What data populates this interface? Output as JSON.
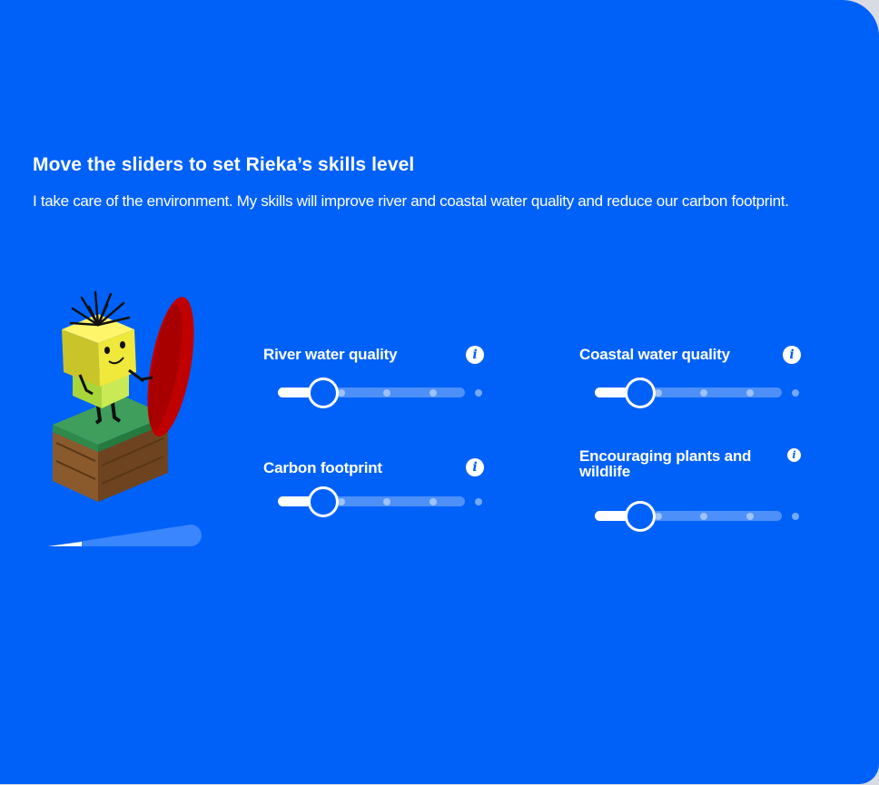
{
  "intro": {
    "heading": "Move the sliders to set Rieka’s skills level",
    "description": "I take care of the environment. My skills will improve river and coastal water quality and reduce our carbon footprint."
  },
  "info_glyph": "i",
  "skills": [
    {
      "label": "River water quality",
      "level": 1,
      "max_level": 5
    },
    {
      "label": "Coastal water quality",
      "level": 1,
      "max_level": 5
    },
    {
      "label": "Carbon footprint",
      "level": 1,
      "max_level": 5
    },
    {
      "label": "Encouraging plants and wildlife",
      "level": 1,
      "max_level": 5
    }
  ],
  "colors": {
    "panel": "#0061f8",
    "text": "#ffffff",
    "surfboard": "#c00000",
    "character_yellow": "#e9e23a",
    "character_green": "#b8e34a",
    "grass": "#3f9e5c",
    "soil": "#8a5a2c"
  },
  "progress_level": 0.2
}
